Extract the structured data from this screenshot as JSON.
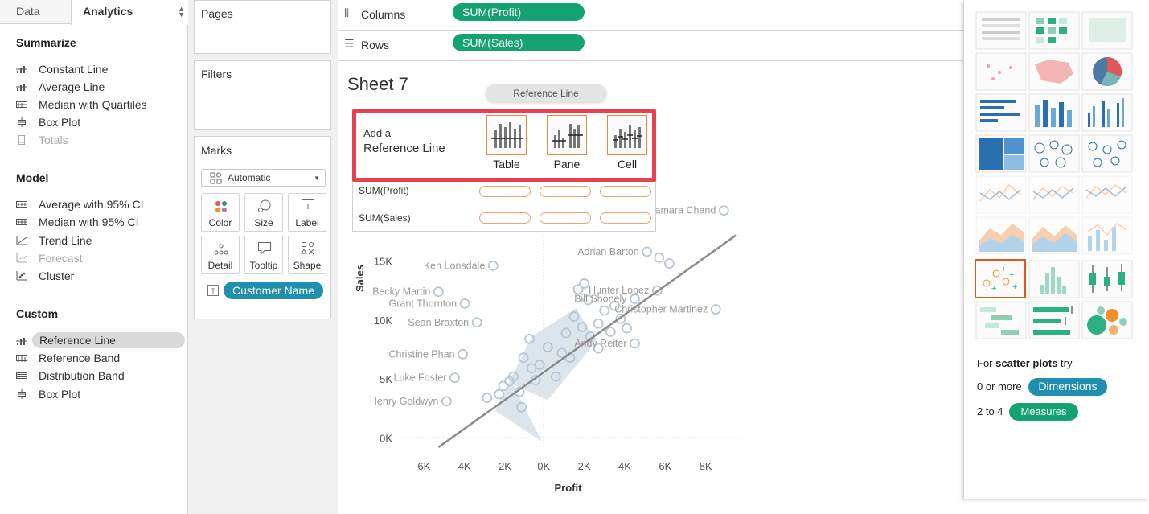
{
  "left_panel": {
    "tabs": {
      "data": "Data",
      "analytics": "Analytics"
    },
    "summarize": {
      "title": "Summarize",
      "items": [
        "Constant Line",
        "Average Line",
        "Median with Quartiles",
        "Box Plot",
        "Totals"
      ]
    },
    "model": {
      "title": "Model",
      "items": [
        "Average with 95% CI",
        "Median with 95% CI",
        "Trend Line",
        "Forecast",
        "Cluster"
      ]
    },
    "custom": {
      "title": "Custom",
      "items": [
        "Reference Line",
        "Reference Band",
        "Distribution Band",
        "Box Plot"
      ]
    }
  },
  "cards": {
    "pages": "Pages",
    "filters": "Filters",
    "marks": {
      "title": "Marks",
      "mark_type": "Automatic",
      "buttons": [
        "Color",
        "Size",
        "Label",
        "Detail",
        "Tooltip",
        "Shape"
      ],
      "field_pill": "Customer Name"
    }
  },
  "shelves": {
    "columns": {
      "label": "Columns",
      "pill": "SUM(Profit)"
    },
    "rows": {
      "label": "Rows",
      "pill": "SUM(Sales)"
    }
  },
  "sheet": {
    "title": "Sheet 7"
  },
  "drag_tooltip": "Reference Line",
  "drop_panel": {
    "add_a": "Add a",
    "reference_line": "Reference Line",
    "scopes": [
      "Table",
      "Pane",
      "Cell"
    ],
    "rows": [
      "SUM(Profit)",
      "SUM(Sales)"
    ]
  },
  "chart_data": {
    "type": "scatter",
    "xlabel": "Profit",
    "ylabel": "Sales",
    "x_ticks": [
      "-6K",
      "-4K",
      "-2K",
      "0K",
      "2K",
      "4K",
      "6K",
      "8K"
    ],
    "x_tick_values": [
      -6000,
      -4000,
      -2000,
      0,
      2000,
      4000,
      6000,
      8000
    ],
    "y_ticks": [
      "0K",
      "5K",
      "10K",
      "15K"
    ],
    "y_tick_values": [
      0,
      5000,
      10000,
      15000
    ],
    "xlim": [
      -7000,
      10000
    ],
    "ylim": [
      -800,
      17500
    ],
    "trend_line": {
      "from": [
        -5200,
        -800
      ],
      "to": [
        9500,
        17200
      ]
    },
    "labels": [
      {
        "text": "Tamara Chand",
        "x": 8900,
        "y": 19300
      },
      {
        "text": "Adrian Barton",
        "x": 5100,
        "y": 15800
      },
      {
        "text": "Ken Lonsdale",
        "x": -2500,
        "y": 14600
      },
      {
        "text": "Hunter Lopez",
        "x": 5600,
        "y": 12500
      },
      {
        "text": "Becky Martin",
        "x": -5200,
        "y": 12400
      },
      {
        "text": "Bill Shonely",
        "x": 4500,
        "y": 11800
      },
      {
        "text": "Grant Thornton",
        "x": -3900,
        "y": 11400
      },
      {
        "text": "Christopher Martinez",
        "x": 8500,
        "y": 10900
      },
      {
        "text": "Sean Braxton",
        "x": -3300,
        "y": 9800
      },
      {
        "text": "Andy Reiter",
        "x": 4500,
        "y": 8000
      },
      {
        "text": "Christine Phan",
        "x": -4000,
        "y": 7100
      },
      {
        "text": "Luke Foster",
        "x": -4400,
        "y": 5100
      },
      {
        "text": "Henry Goldwyn",
        "x": -4800,
        "y": 3100
      }
    ],
    "points": [
      [
        8900,
        19300
      ],
      [
        5100,
        15800
      ],
      [
        -2500,
        14600
      ],
      [
        5600,
        12500
      ],
      [
        -5200,
        12400
      ],
      [
        4500,
        11800
      ],
      [
        -3900,
        11400
      ],
      [
        8500,
        10900
      ],
      [
        -3300,
        9800
      ],
      [
        4500,
        8000
      ],
      [
        -4000,
        7100
      ],
      [
        -4400,
        5100
      ],
      [
        -4800,
        3100
      ],
      [
        6200,
        14800
      ],
      [
        5700,
        15300
      ],
      [
        2200,
        11700
      ],
      [
        1700,
        12600
      ],
      [
        2000,
        13100
      ],
      [
        3500,
        11200
      ],
      [
        -700,
        8400
      ],
      [
        -200,
        6200
      ],
      [
        -1500,
        5200
      ],
      [
        3800,
        10100
      ],
      [
        -400,
        4900
      ],
      [
        1100,
        8900
      ],
      [
        2700,
        9700
      ],
      [
        -1000,
        6800
      ],
      [
        1500,
        10300
      ],
      [
        3000,
        10800
      ],
      [
        -2800,
        3400
      ],
      [
        -2200,
        3700
      ],
      [
        -2000,
        4400
      ],
      [
        -1200,
        3900
      ],
      [
        200,
        7700
      ],
      [
        2300,
        8600
      ],
      [
        4100,
        9300
      ],
      [
        -600,
        5900
      ],
      [
        900,
        7200
      ],
      [
        1900,
        9400
      ],
      [
        -1700,
        4800
      ],
      [
        -1100,
        2600
      ],
      [
        600,
        5200
      ],
      [
        1300,
        6800
      ],
      [
        2700,
        7600
      ],
      [
        3300,
        9000
      ]
    ]
  },
  "showme": {
    "hint_prefix": "For ",
    "hint_bold": "scatter plots",
    "hint_suffix": " try",
    "dims_prefix": "0 or more",
    "dims_pill": "Dimensions",
    "meas_prefix": "2 to 4",
    "meas_pill": "Measures"
  },
  "colors": {
    "accent_green": "#14a26f",
    "accent_blue": "#1f8faf",
    "highlight_red": "#e8404e",
    "active_orange": "#e15a13"
  }
}
